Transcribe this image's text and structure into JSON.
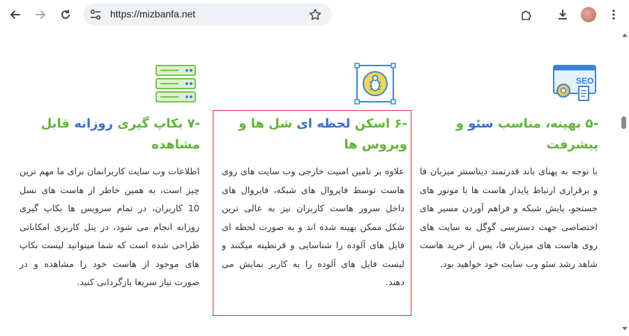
{
  "browser": {
    "url": "https://mizbanfa.net",
    "icons": [
      "back-icon",
      "forward-icon",
      "reload-icon",
      "site-settings-icon",
      "star-icon",
      "extensions-icon",
      "download-icon",
      "avatar",
      "menu-icon"
    ]
  },
  "features": [
    {
      "number": "-۵",
      "title_parts": [
        {
          "text": "بهینه، مناسب ",
          "color": "green"
        },
        {
          "text": "سئو",
          "color": "blue"
        },
        {
          "text": " و پیشرفت",
          "color": "green"
        }
      ],
      "body": "با توجه به پهنای باند قدرتمند دیتاسنتر میزبان فا و برقراری ارتباط پایدار هاست ها با موتور های جستجو، پایش شبکه و فراهم آوردن مسیر های اختصاصی جهت دسترسی گوگل به سایت های روی هاست های میزبان فا، پس از خرید هاست شاهد رشد سئو وب سایت خود خواهید بود.",
      "icon": "seo-icon"
    },
    {
      "number": "-۶",
      "title_parts": [
        {
          "text": "اسکن ",
          "color": "green"
        },
        {
          "text": "لحظه ای",
          "color": "blue"
        },
        {
          "text": " شل ها و ویروس ها",
          "color": "green"
        }
      ],
      "body": "علاوه بر تامین امنیت خارجی وب سایت های روی هاست توسط فایروال های شبکه، فایروال های داخل سرور هاست کاربران نیز به عالی ترین شکل ممکن بهینه شده اند و به صورت لحظه ای فایل های آلوده را شناسایی و قرنطینه میکنند و لیست فایل های آلوده را به کاربر نمایش می دهند.",
      "icon": "virus-scan-icon"
    },
    {
      "number": "-۷",
      "title_parts": [
        {
          "text": "بکاپ گیری ",
          "color": "green"
        },
        {
          "text": "روزانه",
          "color": "blue"
        },
        {
          "text": " قابل مشاهده",
          "color": "green"
        }
      ],
      "body": "اطلاعات وب سایت کاربرانمان برای ما مهم ترین چیز است، به همین خاطر از هاست های نسل 10 کاربران، در تمام سرویس ها بکاپ گیری روزانه انجام می شود، در پنل کاربری امکاناتی طراحی شده است که شما میتوانید لیست بکاپ های موجود از هاست خود را مشاهده و در صورت نیاز سریعا بازگردانی کنید.",
      "icon": "backup-server-icon"
    }
  ],
  "colors": {
    "green": "#5fb536",
    "blue": "#3b6fcf",
    "highlight": "#d93030"
  }
}
